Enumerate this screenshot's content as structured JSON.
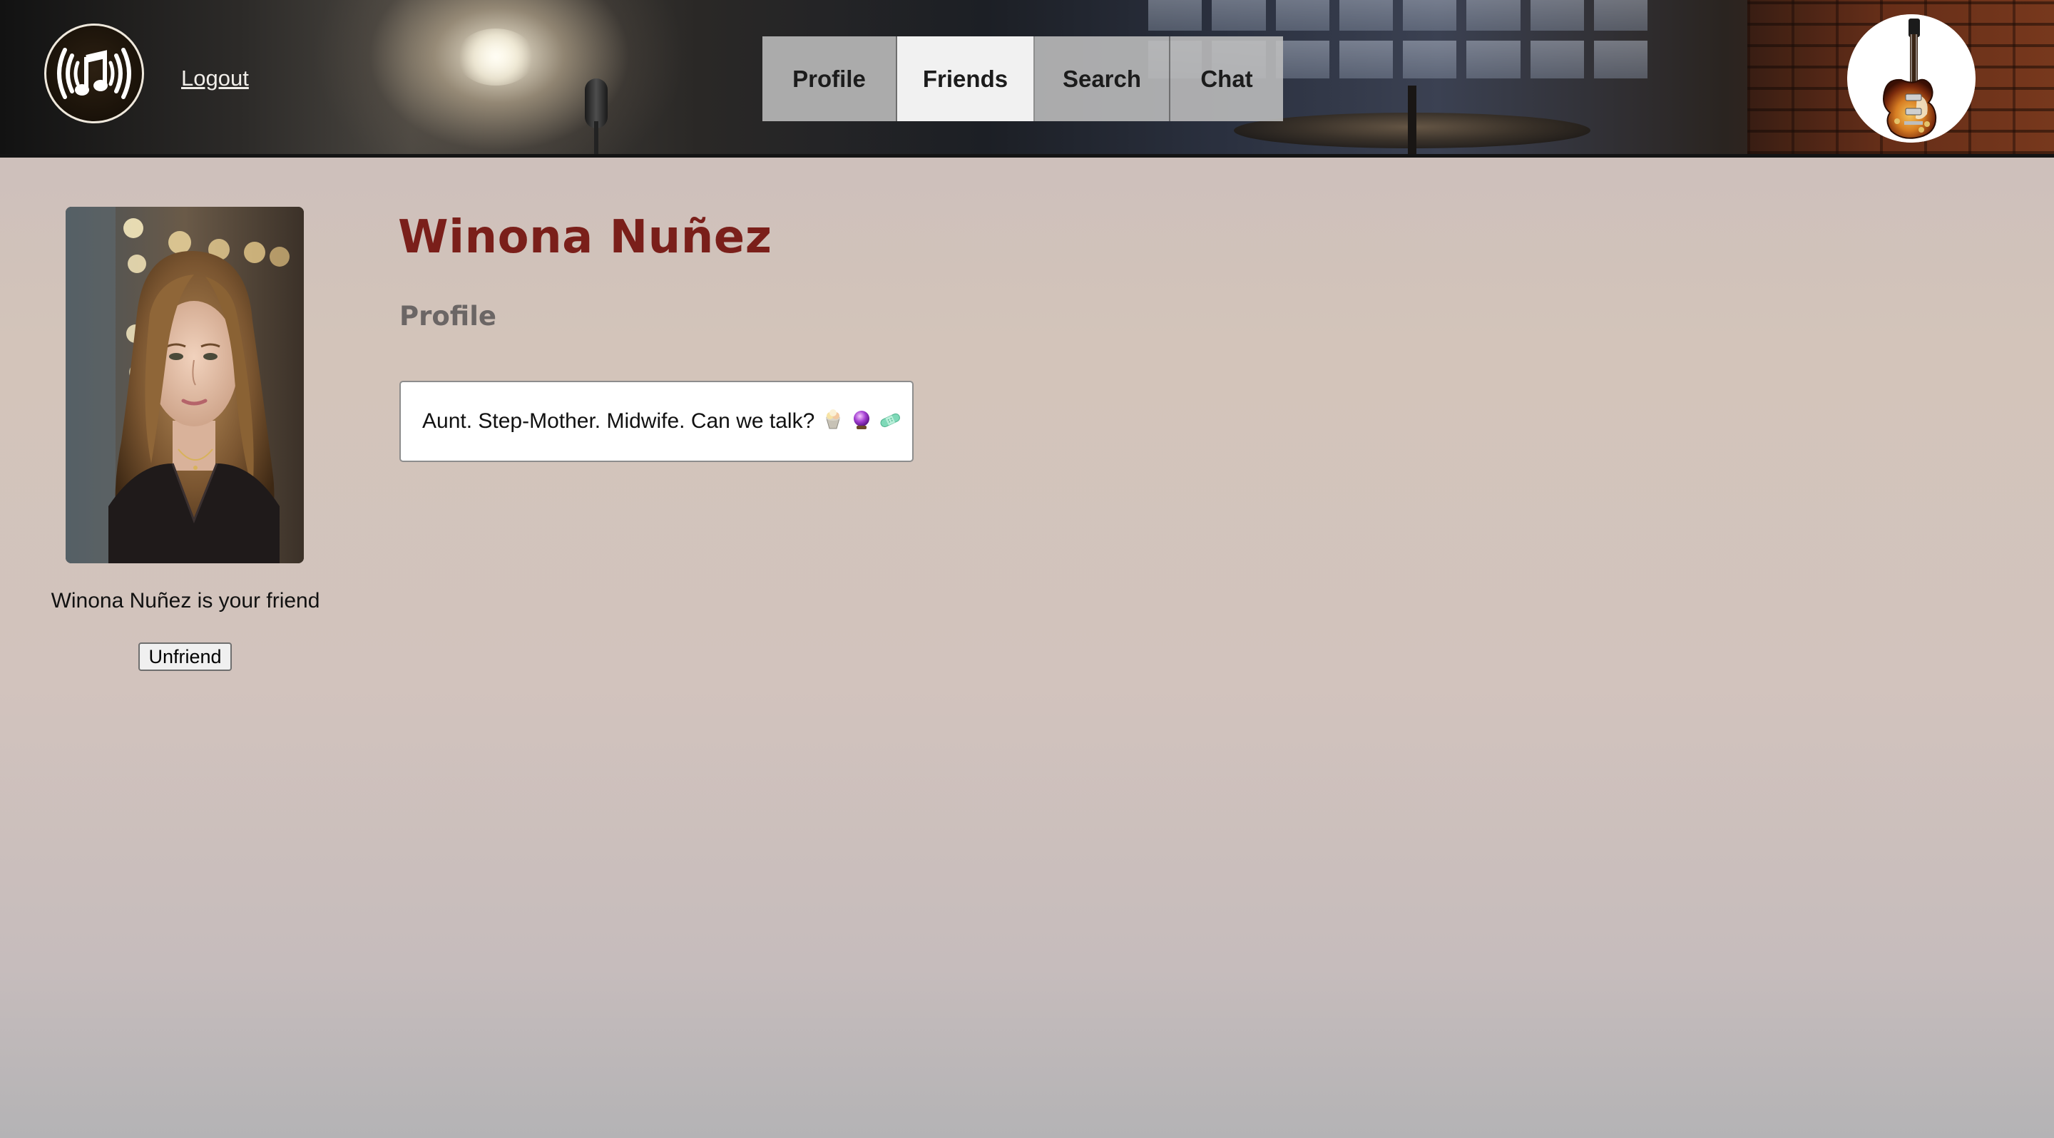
{
  "header": {
    "logo_icon": "music-note-broadcast-icon",
    "logout_label": "Logout",
    "nav_tabs": [
      {
        "label": "Profile",
        "active": false
      },
      {
        "label": "Friends",
        "active": true
      },
      {
        "label": "Search",
        "active": false
      },
      {
        "label": "Chat",
        "active": false
      }
    ],
    "user_avatar_icon": "electric-guitar-avatar"
  },
  "friend": {
    "name": "Winona Nuñez",
    "status_text": "Winona Nuñez is your friend",
    "unfriend_label": "Unfriend",
    "photo": "portrait-photo"
  },
  "profile": {
    "section_title": "Profile",
    "bio": "Aunt. Step-Mother. Midwife. Can we talk?",
    "bio_emoji_icons": [
      "ice-cream-icon",
      "crystal-ball-icon",
      "adhesive-bandage-icon"
    ]
  },
  "colors": {
    "name_color": "#7a1f1a",
    "section_title_color": "#6b6665",
    "active_tab_bg": "#f1f1f1",
    "inactive_tab_bg": "#bebebe"
  }
}
